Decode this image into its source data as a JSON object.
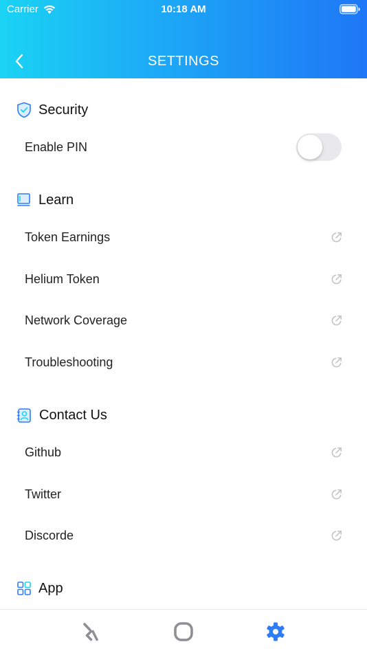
{
  "status_bar": {
    "carrier": "Carrier",
    "time": "10:18 AM"
  },
  "nav": {
    "title": "SETTINGS"
  },
  "sections": {
    "security": {
      "title": "Security",
      "items": [
        {
          "label": "Enable PIN",
          "type": "toggle",
          "on": false
        }
      ]
    },
    "learn": {
      "title": "Learn",
      "items": [
        {
          "label": "Token Earnings"
        },
        {
          "label": "Helium Token"
        },
        {
          "label": "Network Coverage"
        },
        {
          "label": "Troubleshooting"
        }
      ]
    },
    "contact": {
      "title": "Contact Us",
      "items": [
        {
          "label": "Github"
        },
        {
          "label": "Twitter"
        },
        {
          "label": "Discorde"
        }
      ]
    },
    "app": {
      "title": "App"
    }
  },
  "tab_bar": {
    "tabs": [
      {
        "icon": "helium-logo-icon",
        "active": false
      },
      {
        "icon": "hotspot-icon",
        "active": false
      },
      {
        "icon": "gear-icon",
        "active": true
      }
    ]
  },
  "colors": {
    "header_gradient_start": "#1ad3f4",
    "header_gradient_end": "#1e77f6",
    "accent_blue": "#2e7cf6",
    "icon_gray": "#c4c4c6",
    "tab_inactive": "#8e8e93"
  }
}
